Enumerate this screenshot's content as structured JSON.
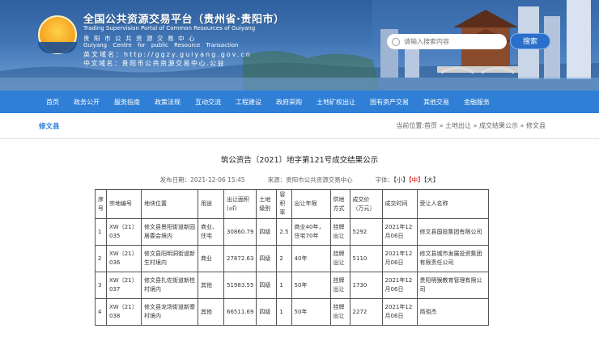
{
  "header": {
    "title": "全国公共资源交易平台（贵州省·贵阳市）",
    "subtitle_en": "Trading Supervision Portal of Common Resources of Guiyang",
    "org_cn": "贵阳市公共资源交易中心",
    "org_en": "Guiyang Centre for public Resource Transaction",
    "url_line": "英文域名：http://ggzy.guiyang.gov.cn",
    "cn_domain_line": "中文域名：贵阳市公共资源交易中心.公益",
    "search_placeholder": "请输入搜索内容",
    "search_label": "搜索"
  },
  "nav": {
    "items": [
      "首页",
      "政务公开",
      "服务指南",
      "政策法规",
      "互动交流",
      "工程建设",
      "政府采购",
      "土地矿权出让",
      "国有资产交易",
      "其他交易",
      "金融服务"
    ]
  },
  "breadcrumb": {
    "area": "修文县",
    "path": "当前位置:首页 » 土地出让 » 成交结果公示 » 修文县"
  },
  "article": {
    "title": "筑公资告〔2021〕地字第121号成交结果公示",
    "date": "发布日期：2021-12-06 15:45",
    "source": "来源：贵阳市公共资源交易中心",
    "font_label": "字体：",
    "font_small": "【小】",
    "font_mid": "【中】",
    "font_large": "【大】"
  },
  "table": {
    "headers": [
      "序号",
      "宗地编号",
      "地块位置",
      "用途",
      "出让面积(㎡)",
      "土地级别",
      "容积率",
      "出让年限",
      "供地方式",
      "成交价（万元）",
      "成交时间",
      "受让人名称"
    ],
    "rows": [
      [
        "1",
        "XW〔21〕035",
        "修文县景阳街道新园居委会境内",
        "商业、住宅",
        "30860.79",
        "四级",
        "2.5",
        "商业40年，住宅70年",
        "挂牌出让",
        "5292",
        "2021年12月06日",
        "修文县国投集团有限公司"
      ],
      [
        "2",
        "XW〔21〕036",
        "修文县阳明洞街道新生村境内",
        "商业",
        "27872.63",
        "四级",
        "2",
        "40年",
        "挂牌出让",
        "5110",
        "2021年12月06日",
        "修文县城市发展投资集团有限责任公司"
      ],
      [
        "3",
        "XW〔21〕037",
        "修文县扎佐街道新桂村境内",
        "其他",
        "51983.55",
        "四级",
        "1",
        "50年",
        "挂牌出让",
        "1730",
        "2021年12月06日",
        "贵阳明猴教育管理有限公司"
      ],
      [
        "4",
        "XW〔21〕038",
        "修文县龙场街道新寨村境内",
        "其他",
        "66511.69",
        "四级",
        "1",
        "50年",
        "挂牌出让",
        "2272",
        "2021年12月06日",
        "简祖杰"
      ]
    ]
  }
}
